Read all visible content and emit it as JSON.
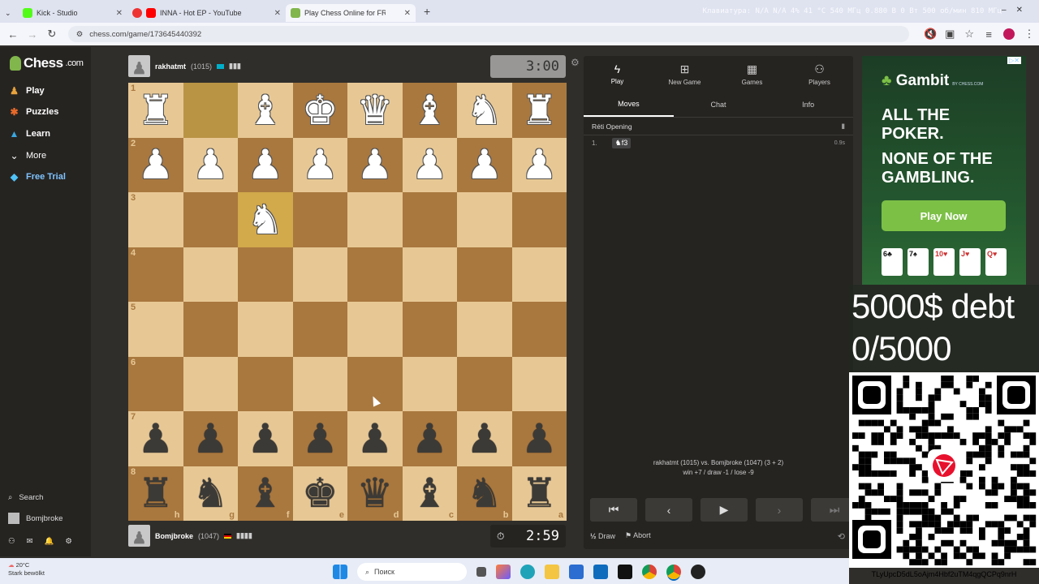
{
  "browser": {
    "tabs": [
      {
        "label": "Kick - Studio",
        "color": "#53fc18"
      },
      {
        "label": "INNA - Hot EP - YouTube",
        "color": "#ff0000"
      },
      {
        "label": "Play Chess Online for FREE",
        "color": "#81b64c"
      }
    ],
    "new_tab": "+",
    "url": "chess.com/game/173645440392",
    "sysinfo": "Клавиатура: N/A  N/A   4%  41 °C  540 МГц  0.880 В  0 Вт  500 об/мин  810 МГц"
  },
  "sidebar": {
    "logo": "Chess",
    "logo_suffix": ".com",
    "items": [
      {
        "label": "Play",
        "icon": "play-icon"
      },
      {
        "label": "Puzzles",
        "icon": "puzzle-icon"
      },
      {
        "label": "Learn",
        "icon": "learn-icon"
      },
      {
        "label": "More",
        "icon": "chevron-down-icon"
      },
      {
        "label": "Free Trial",
        "icon": "diamond-icon"
      }
    ],
    "search": "Search",
    "username": "Bomjbroke"
  },
  "top_player": {
    "name": "rakhatmt",
    "rating": "(1015)",
    "clock": "3:00"
  },
  "bottom_player": {
    "name": "Bomjbroke",
    "rating": "(1047)",
    "clock": "2:59"
  },
  "board": {
    "ranks": [
      "1",
      "2",
      "3",
      "4",
      "5",
      "6",
      "7",
      "8"
    ],
    "files": [
      "h",
      "g",
      "f",
      "e",
      "d",
      "c",
      "b",
      "a"
    ],
    "rows": [
      [
        "wR",
        "",
        "wB",
        "wK",
        "wQ",
        "wB",
        "wN",
        "wR"
      ],
      [
        "wP",
        "wP",
        "wP",
        "wP",
        "wP",
        "wP",
        "wP",
        "wP"
      ],
      [
        "",
        "",
        "wN",
        "",
        "",
        "",
        "",
        ""
      ],
      [
        "",
        "",
        "",
        "",
        "",
        "",
        "",
        ""
      ],
      [
        "",
        "",
        "",
        "",
        "",
        "",
        "",
        ""
      ],
      [
        "",
        "",
        "",
        "",
        "",
        "",
        "",
        ""
      ],
      [
        "bP",
        "bP",
        "bP",
        "bP",
        "bP",
        "bP",
        "bP",
        "bP"
      ],
      [
        "bR",
        "bN",
        "bB",
        "bK",
        "bQ",
        "bB",
        "bN",
        "bR"
      ]
    ]
  },
  "panel": {
    "tabs": [
      {
        "label": "Play",
        "icon": "lightning-icon"
      },
      {
        "label": "New Game",
        "icon": "plus-icon"
      },
      {
        "label": "Games",
        "icon": "grid-icon"
      },
      {
        "label": "Players",
        "icon": "players-icon"
      }
    ],
    "subtabs": [
      "Moves",
      "Chat",
      "Info"
    ],
    "opening": "Réti Opening",
    "move_number": "1.",
    "move_text": "♞f3",
    "move_time": "0.9s",
    "game_line1": "rakhatmt (1015) vs. Bomjbroke (1047) (3 + 2)",
    "game_line2": "win +7 / draw -1 / lose -9",
    "draw": "Draw",
    "draw_prefix": "½",
    "abort": "Abort"
  },
  "ad": {
    "logo": "Gambit",
    "logo_sub": "BY CHESS.COM",
    "line1": "ALL THE POKER.",
    "line2": "NONE OF THE GAMBLING.",
    "button": "Play Now",
    "cards": [
      "6♣",
      "7♠",
      "10♥",
      "J♥",
      "Q♥"
    ]
  },
  "overlay": {
    "line1": "5000$ debt",
    "line2": "0/5000",
    "address": "TLyUpcD5dL5oAjm4Hbf2uTM4qgQCPq9nrH"
  },
  "taskbar": {
    "temp": "20°C",
    "weather": "Stark bewölkt",
    "search": "Поиск"
  }
}
